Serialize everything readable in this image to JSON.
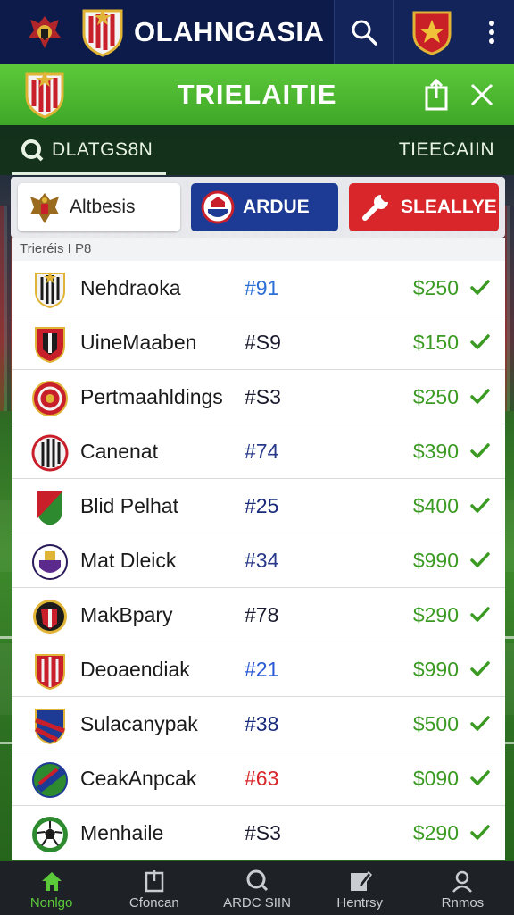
{
  "top_bar": {
    "app_title": "OLAHNGASIA",
    "icons": [
      "club-crest-icon",
      "shield-crest-icon",
      "search-icon",
      "club-badge-icon",
      "more-vert-icon"
    ]
  },
  "section_header": {
    "title": "TRIELAITIE",
    "icons": [
      "shield-crest-icon",
      "share-icon",
      "close-icon"
    ]
  },
  "sub_bar": {
    "search_label": "DLATGS8N",
    "right_label": "TIEECAIIN"
  },
  "filter_chips": [
    {
      "label": "Altbesis",
      "icon": "eagle-crest-icon"
    },
    {
      "label": "ARDUE",
      "icon": "club-badge-icon"
    },
    {
      "label": "SLEALLYE",
      "icon": "wrench-icon"
    }
  ],
  "list": {
    "caption": "Trieréis I P8",
    "rows": [
      {
        "name": "Nehdraoka",
        "number": "#91",
        "price": "$250",
        "num_color": "#2c6fd6"
      },
      {
        "name": "UineMaaben",
        "number": "#S9",
        "price": "$150",
        "num_color": "#1a1a2e"
      },
      {
        "name": "Pertmaahldings",
        "number": "#S3",
        "price": "$250",
        "num_color": "#1a1a2e"
      },
      {
        "name": "Canenat",
        "number": "#74",
        "price": "$390",
        "num_color": "#2a3a8a"
      },
      {
        "name": "Blid Pelhat",
        "number": "#25",
        "price": "$400",
        "num_color": "#1a2a7a"
      },
      {
        "name": "Mat Dleick",
        "number": "#34",
        "price": "$990",
        "num_color": "#2a3a8a"
      },
      {
        "name": "MakBpary",
        "number": "#78",
        "price": "$290",
        "num_color": "#1a1a2e"
      },
      {
        "name": "Deoaendiak",
        "number": "#21",
        "price": "$990",
        "num_color": "#2a5ad6"
      },
      {
        "name": "Sulacanypak",
        "number": "#38",
        "price": "$500",
        "num_color": "#1a2a7a"
      },
      {
        "name": "CeakAnpcak",
        "number": "#63",
        "price": "$090",
        "num_color": "#d8262a"
      },
      {
        "name": "Menhaile",
        "number": "#S3",
        "price": "$290",
        "num_color": "#1a1a2e"
      }
    ]
  },
  "bottom_nav": [
    {
      "label": "Nonlgo",
      "icon": "home-icon",
      "active": true
    },
    {
      "label": "Cfoncan",
      "icon": "clipboard-icon",
      "active": false
    },
    {
      "label": "ARDC SIIN",
      "icon": "search-icon",
      "active": false
    },
    {
      "label": "Hentrsy",
      "icon": "edit-icon",
      "active": false
    },
    {
      "label": "Rnmos",
      "icon": "profile-icon",
      "active": false
    }
  ],
  "colors": {
    "top_bar": "#0d1b4a",
    "header_green": "#4bb830",
    "price_green": "#3a9a22",
    "chip_blue": "#1d3b94",
    "chip_red": "#d8262a"
  }
}
